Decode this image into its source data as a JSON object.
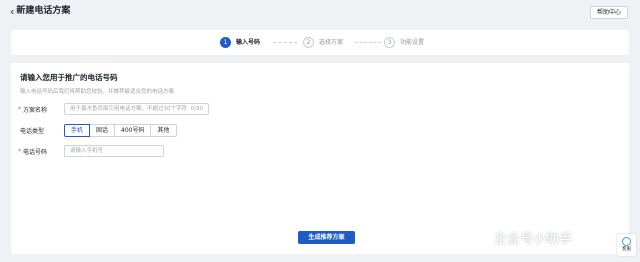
{
  "header": {
    "back_icon": "chevron-left-icon",
    "title": "新建电话方案",
    "help_label": "帮助中心"
  },
  "steps": [
    {
      "number": "1",
      "label": "输入号码",
      "active": true
    },
    {
      "number": "2",
      "label": "选择方案",
      "active": false
    },
    {
      "number": "3",
      "label": "功能设置",
      "active": false
    }
  ],
  "form": {
    "title": "请输入您用于推广的电话号码",
    "description": "输入电话号码后我们将帮助您校验，并推荐最适合您的电话方案",
    "plan_name": {
      "label": "方案名称",
      "placeholder": "用于基木鱼页面引用电话方案，不超过30个字符",
      "counter": "0/30"
    },
    "phone_type": {
      "label": "电话类型",
      "options": [
        "手机",
        "固话",
        "400号码",
        "其他"
      ],
      "selected": "手机"
    },
    "phone_number": {
      "label": "电话号码",
      "placeholder": "请输入手机号"
    },
    "submit_label": "生成推荐方案"
  },
  "watermark": "企业号小助手",
  "float_button": {
    "icon": "support-icon",
    "label": "客服"
  },
  "colors": {
    "accent": "#1f5cc8",
    "required": "#e34d59",
    "background": "#f0f1f5"
  }
}
